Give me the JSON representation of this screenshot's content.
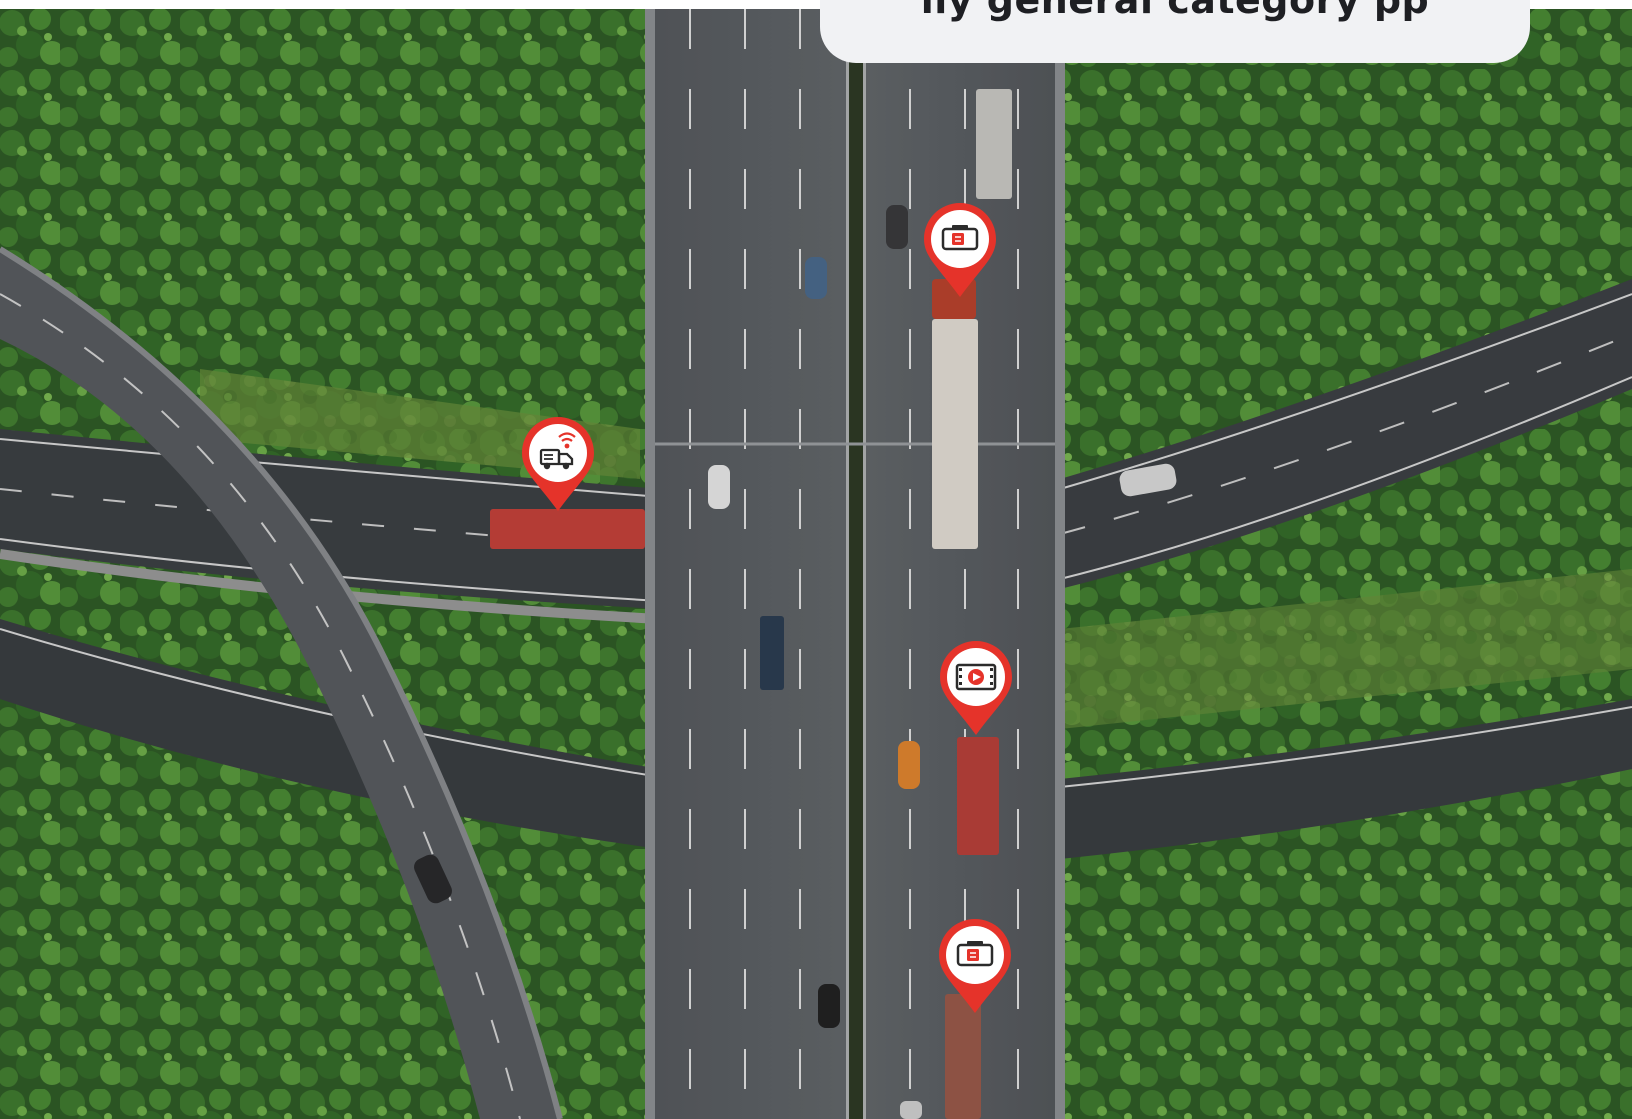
{
  "overlay_card": {
    "text": "ily general category pp"
  },
  "markers": [
    {
      "id": "marker-camera-top",
      "icon": "dashcam-icon",
      "color": "#e5332a"
    },
    {
      "id": "marker-connected-truck",
      "icon": "wireless-truck-icon",
      "color": "#e5332a"
    },
    {
      "id": "marker-video-middle",
      "icon": "video-play-icon",
      "color": "#e5332a"
    },
    {
      "id": "marker-camera-bottom",
      "icon": "dashcam-icon",
      "color": "#e5332a"
    }
  ],
  "colors": {
    "accent": "#e5332a",
    "forest": "#2f5a25",
    "road": "#5b5f63"
  }
}
